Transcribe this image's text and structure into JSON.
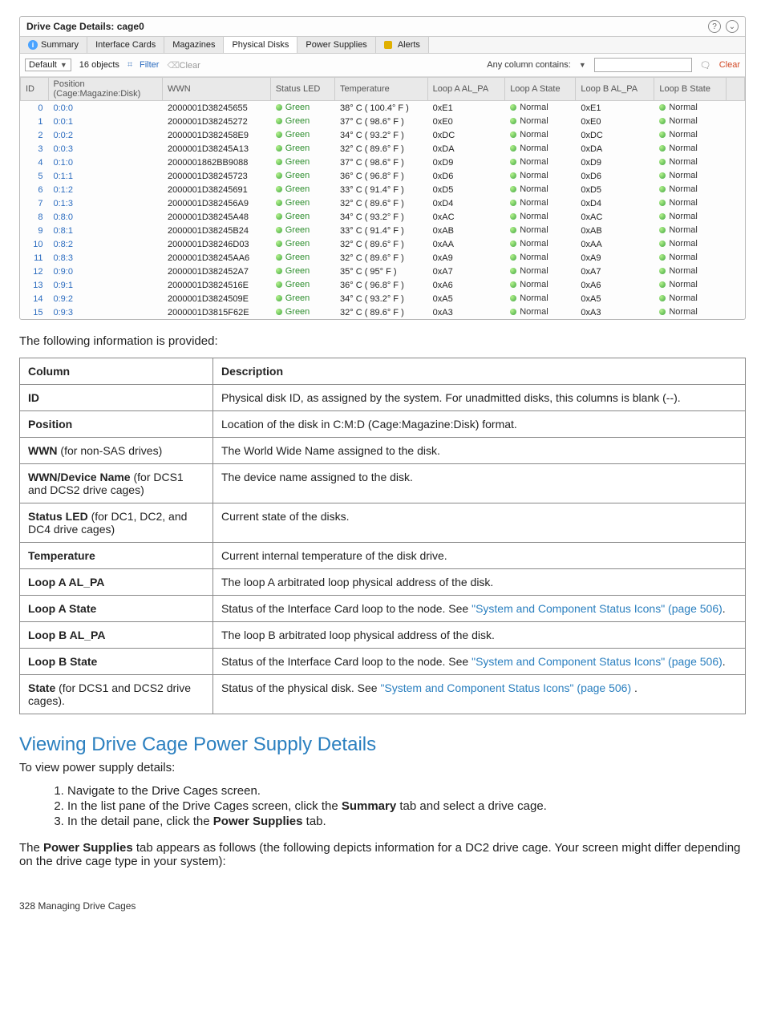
{
  "panel": {
    "title": "Drive Cage Details: cage0",
    "tabs": {
      "summary": "Summary",
      "interface": "Interface Cards",
      "magazines": "Magazines",
      "physical": "Physical Disks",
      "power": "Power Supplies",
      "alerts": "Alerts"
    },
    "toolbar": {
      "view": "Default",
      "count": "16 objects",
      "filter": "Filter",
      "clearFilter": "Clear",
      "anycol": "Any column contains:",
      "clear": "Clear"
    },
    "headers": {
      "id": "ID",
      "position_l1": "Position",
      "position_l2": "(Cage:Magazine:Disk)",
      "wwn": "WWN",
      "status": "Status LED",
      "temp": "Temperature",
      "loopA_al": "Loop A AL_PA",
      "loopA_state": "Loop A State",
      "loopB_al": "Loop B AL_PA",
      "loopB_state": "Loop B State"
    },
    "green": "Green",
    "normal": "Normal",
    "rows": [
      {
        "id": "0",
        "pos": "0:0:0",
        "wwn": "2000001D38245655",
        "temp": "38° C ( 100.4° F )",
        "la": "0xE1",
        "lb": "0xE1"
      },
      {
        "id": "1",
        "pos": "0:0:1",
        "wwn": "2000001D38245272",
        "temp": "37° C ( 98.6° F )",
        "la": "0xE0",
        "lb": "0xE0"
      },
      {
        "id": "2",
        "pos": "0:0:2",
        "wwn": "2000001D382458E9",
        "temp": "34° C ( 93.2° F )",
        "la": "0xDC",
        "lb": "0xDC"
      },
      {
        "id": "3",
        "pos": "0:0:3",
        "wwn": "2000001D38245A13",
        "temp": "32° C ( 89.6° F )",
        "la": "0xDA",
        "lb": "0xDA"
      },
      {
        "id": "4",
        "pos": "0:1:0",
        "wwn": "2000001862BB9088",
        "temp": "37° C ( 98.6° F )",
        "la": "0xD9",
        "lb": "0xD9"
      },
      {
        "id": "5",
        "pos": "0:1:1",
        "wwn": "2000001D38245723",
        "temp": "36° C ( 96.8° F )",
        "la": "0xD6",
        "lb": "0xD6"
      },
      {
        "id": "6",
        "pos": "0:1:2",
        "wwn": "2000001D38245691",
        "temp": "33° C ( 91.4° F )",
        "la": "0xD5",
        "lb": "0xD5"
      },
      {
        "id": "7",
        "pos": "0:1:3",
        "wwn": "2000001D382456A9",
        "temp": "32° C ( 89.6° F )",
        "la": "0xD4",
        "lb": "0xD4"
      },
      {
        "id": "8",
        "pos": "0:8:0",
        "wwn": "2000001D38245A48",
        "temp": "34° C ( 93.2° F )",
        "la": "0xAC",
        "lb": "0xAC"
      },
      {
        "id": "9",
        "pos": "0:8:1",
        "wwn": "2000001D38245B24",
        "temp": "33° C ( 91.4° F )",
        "la": "0xAB",
        "lb": "0xAB"
      },
      {
        "id": "10",
        "pos": "0:8:2",
        "wwn": "2000001D38246D03",
        "temp": "32° C ( 89.6° F )",
        "la": "0xAA",
        "lb": "0xAA"
      },
      {
        "id": "11",
        "pos": "0:8:3",
        "wwn": "2000001D38245AA6",
        "temp": "32° C ( 89.6° F )",
        "la": "0xA9",
        "lb": "0xA9"
      },
      {
        "id": "12",
        "pos": "0:9:0",
        "wwn": "2000001D382452A7",
        "temp": "35° C ( 95° F )",
        "la": "0xA7",
        "lb": "0xA7"
      },
      {
        "id": "13",
        "pos": "0:9:1",
        "wwn": "2000001D3824516E",
        "temp": "36° C ( 96.8° F )",
        "la": "0xA6",
        "lb": "0xA6"
      },
      {
        "id": "14",
        "pos": "0:9:2",
        "wwn": "2000001D3824509E",
        "temp": "34° C ( 93.2° F )",
        "la": "0xA5",
        "lb": "0xA5"
      },
      {
        "id": "15",
        "pos": "0:9:3",
        "wwn": "2000001D3815F62E",
        "temp": "32° C ( 89.6° F )",
        "la": "0xA3",
        "lb": "0xA3"
      }
    ]
  },
  "doc": {
    "lead": "The following information is provided:",
    "table": {
      "colhead": "Column",
      "deschead": "Description",
      "rows": [
        {
          "name": "ID",
          "bold": "ID",
          "desc": "Physical disk ID, as assigned by the system. For unadmitted disks, this columns is blank (--)."
        },
        {
          "name": "Position",
          "bold": "Position",
          "desc": "Location of the disk in C:M:D (Cage:Magazine:Disk) format."
        },
        {
          "name": "WWN",
          "bold": "WWN",
          "tail": " (for non-SAS drives)",
          "desc": "The World Wide Name assigned to the disk."
        },
        {
          "name": "WWNDev",
          "bold": "WWN/Device Name",
          "tail": " (for DCS1 and DCS2 drive cages)",
          "desc": "The device name assigned to the disk."
        },
        {
          "name": "StatusLED",
          "bold": "Status LED",
          "tail": " (for DC1, DC2, and DC4 drive cages)",
          "desc": "Current state of the disks."
        },
        {
          "name": "Temperature",
          "bold": "Temperature",
          "desc": "Current internal temperature of the disk drive."
        },
        {
          "name": "LoopAAL",
          "bold": "Loop A AL_PA",
          "desc": "The loop A arbitrated loop physical address of the disk."
        },
        {
          "name": "LoopAState",
          "bold": "Loop A State",
          "descPre": "Status of the Interface Card loop to the node. See ",
          "link": "\"System and Component Status Icons\" (page 506)",
          "descPost": "."
        },
        {
          "name": "LoopBAL",
          "bold": "Loop B AL_PA",
          "desc": "The loop B arbitrated loop physical address of the disk."
        },
        {
          "name": "LoopBState",
          "bold": "Loop B State",
          "descPre": "Status of the Interface Card loop to the node. See ",
          "link": "\"System and Component Status Icons\" (page 506)",
          "descPost": "."
        },
        {
          "name": "State",
          "bold": "State",
          "tail": " (for DCS1 and DCS2 drive cages).",
          "descPre": "Status of the physical disk. See ",
          "link": "\"System and Component Status Icons\" (page 506)",
          "descPost": " ."
        }
      ]
    }
  },
  "section": {
    "title": "Viewing Drive Cage Power Supply Details",
    "intro": "To view power supply details:",
    "steps": {
      "s1": "Navigate to the Drive Cages screen.",
      "s2pre": "In the list pane of the Drive Cages screen, click the ",
      "s2bold": "Summary",
      "s2post": " tab and select a drive cage.",
      "s3pre": "In the detail pane, click the ",
      "s3bold": "Power Supplies",
      "s3post": " tab."
    },
    "parapre": "The ",
    "parabold": "Power Supplies",
    "parapost": " tab appears as follows (the following depicts information for a DC2 drive cage. Your screen might differ depending on the drive cage type in your system):"
  },
  "footer": "328   Managing Drive Cages"
}
